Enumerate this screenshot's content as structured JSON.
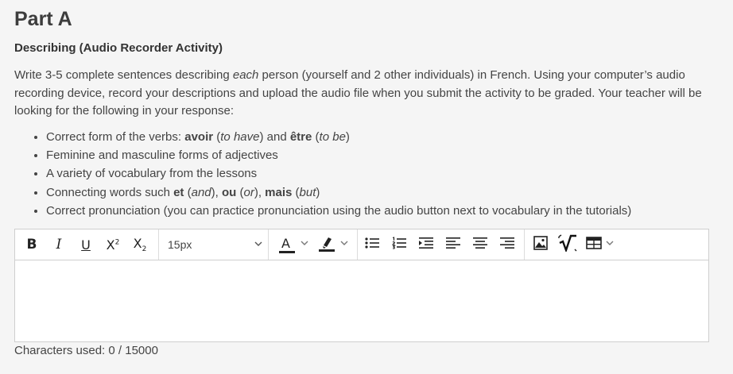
{
  "header": {
    "title": "Part A",
    "subtitle": "Describing (Audio Recorder Activity)"
  },
  "instructions": {
    "part1": "Write 3-5 complete sentences describing ",
    "emph": "each",
    "part2": " person (yourself and 2 other individuals) in French. Using your computer’s audio recording device, record your descriptions and upload the audio file when you submit the activity to be graded. Your teacher will be looking for the following in your response:"
  },
  "bullets": {
    "b1": {
      "t1": "Correct form of the verbs: ",
      "avoir": "avoir",
      "t2": " (",
      "to_have": "to have",
      "t3": ") and ",
      "etre": "être",
      "t4": " (",
      "to_be": "to be",
      "t5": ")"
    },
    "b2": "Feminine and masculine forms of adjectives",
    "b3": "A variety of vocabulary from the lessons",
    "b4": {
      "t1": "Connecting words such ",
      "et": "et",
      "t2": " (",
      "and": "and",
      "t3": "), ",
      "ou": "ou",
      "t4": " (",
      "or": "or",
      "t5": "), ",
      "mais": "mais",
      "t6": " (",
      "but": "but",
      "t7": ")"
    },
    "b5": "Correct pronunciation (you can practice pronunciation using the audio button next to vocabulary in the tutorials)"
  },
  "toolbar": {
    "bold": "B",
    "italic": "I",
    "underline": "U",
    "superscript_base": "X",
    "superscript_mark": "2",
    "subscript_base": "X",
    "subscript_mark": "2",
    "font_size": "15px",
    "text_color_letter": "A"
  },
  "footer": {
    "chars_label": "Characters used: ",
    "chars_used": "0",
    "chars_sep": " / ",
    "chars_max": "15000"
  }
}
